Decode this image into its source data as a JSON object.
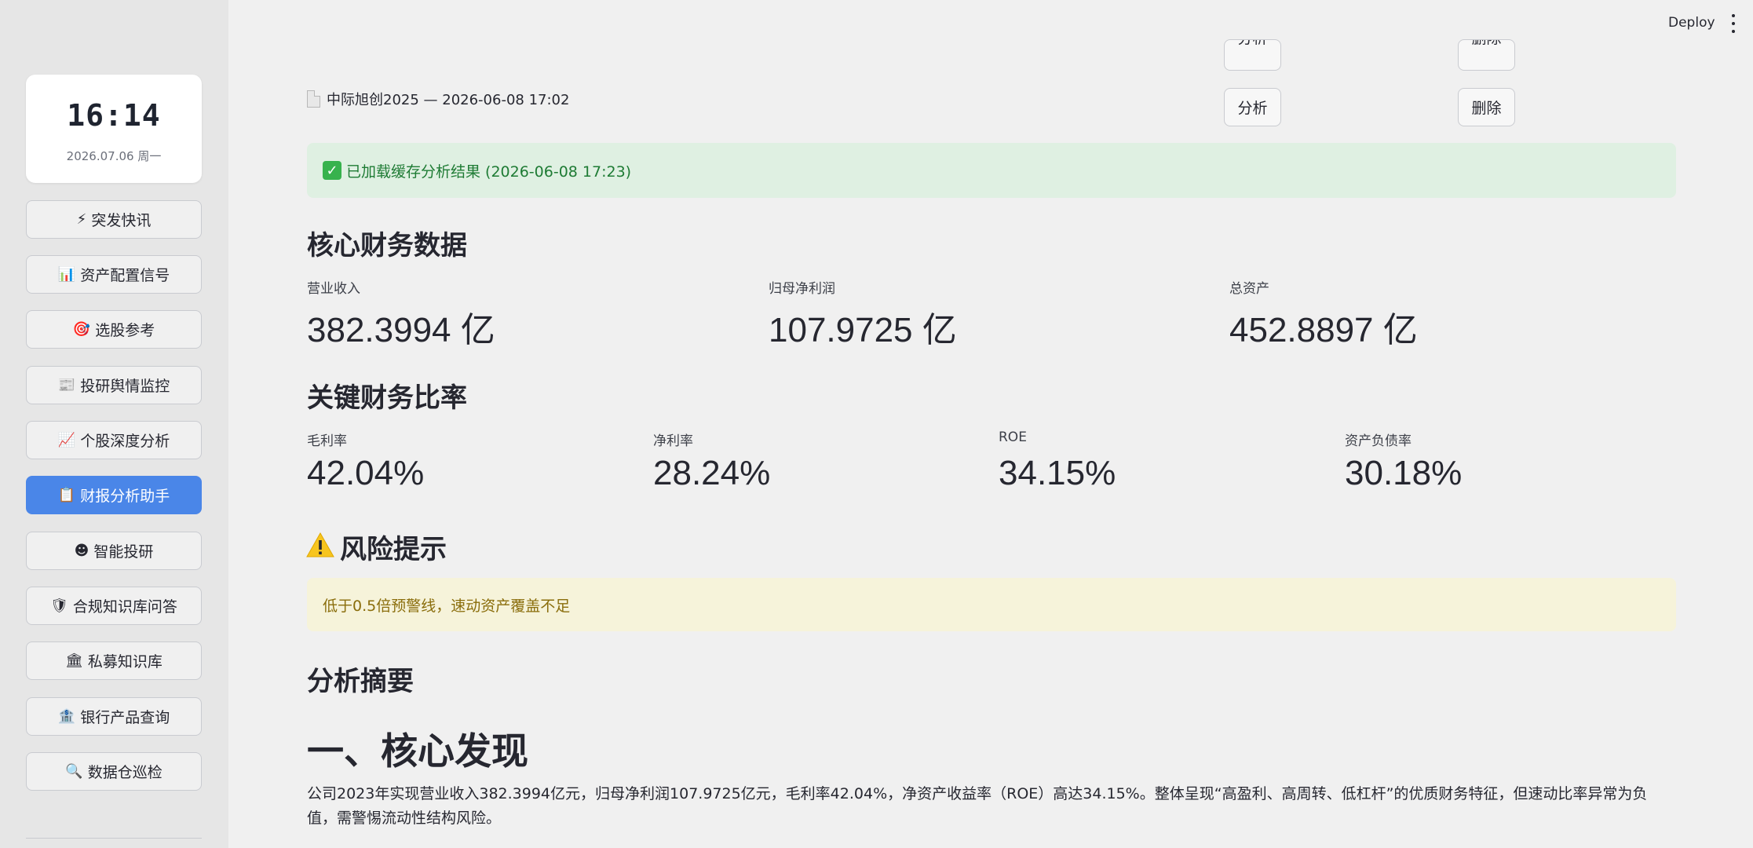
{
  "header": {
    "deploy_label": "Deploy"
  },
  "sidebar": {
    "clock": {
      "time": "16:14",
      "date": "2026.07.06 周一"
    },
    "items": [
      {
        "icon": "⚡",
        "label": "突发快讯"
      },
      {
        "icon": "📊",
        "label": "资产配置信号"
      },
      {
        "icon": "🎯",
        "label": "选股参考"
      },
      {
        "icon": "📰",
        "label": "投研舆情监控"
      },
      {
        "icon": "📈",
        "label": "个股深度分析"
      },
      {
        "icon": "📋",
        "label": "财报分析助手",
        "active": true
      },
      {
        "icon": "☻",
        "label": "智能投研"
      },
      {
        "icon": "🛡",
        "label": "合规知识库问答"
      },
      {
        "icon": "🏛",
        "label": "私募知识库"
      },
      {
        "icon": "🏦",
        "label": "银行产品查询"
      },
      {
        "icon": "🔍",
        "label": "数据仓巡检"
      }
    ]
  },
  "report_list": {
    "prev_row": {
      "analyze_label": "分析",
      "delete_label": "删除"
    },
    "row": {
      "title": "中际旭创2025 — 2026-06-08 17:02",
      "analyze_label": "分析",
      "delete_label": "删除"
    }
  },
  "status": {
    "success": "已加载缓存分析结果 (2026-06-08 17:23)"
  },
  "core": {
    "heading": "核心财务数据",
    "metrics": [
      {
        "label": "营业收入",
        "value": "382.3994 亿"
      },
      {
        "label": "归母净利润",
        "value": "107.9725 亿"
      },
      {
        "label": "总资产",
        "value": "452.8897 亿"
      }
    ]
  },
  "ratios": {
    "heading": "关键财务比率",
    "metrics": [
      {
        "label": "毛利率",
        "value": "42.04%"
      },
      {
        "label": "净利率",
        "value": "28.24%"
      },
      {
        "label": "ROE",
        "value": "34.15%"
      },
      {
        "label": "资产负债率",
        "value": "30.18%"
      }
    ]
  },
  "risk": {
    "heading": "风险提示",
    "warning": "低于0.5倍预警线，速动资产覆盖不足"
  },
  "summary": {
    "heading": "分析摘要",
    "section_title": "一、核心发现",
    "paragraph": "公司2023年实现营业收入382.3994亿元，归母净利润107.9725亿元，毛利率42.04%，净资产收益率（ROE）高达34.15%。整体呈现“高盈利、高周转、低杠杆”的优质财务特征，但速动比率异常为负值，需警惕流动性结构风险。"
  },
  "colors": {
    "accent": "#4a86e8",
    "success_bg": "#dff0e2",
    "success_text": "#1e7b34",
    "warning_bg": "#f6f3da",
    "warning_text": "#8a6d0b"
  }
}
